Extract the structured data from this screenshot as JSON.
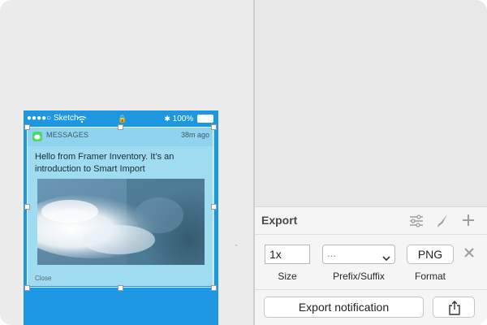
{
  "canvas": {
    "status_bar": {
      "carrier": "●●●●○ Sketch",
      "lock": "🔒",
      "battery": "100%"
    },
    "notification": {
      "app_name": "MESSAGES",
      "time": "38m ago",
      "message": "Hello from Framer Inventory. It’s an introduction to Smart Import",
      "action": "Close"
    }
  },
  "export_panel": {
    "title": "Export",
    "header_icons": [
      "sliders-icon",
      "slice-knife-icon",
      "plus-icon"
    ],
    "size_value": "1x",
    "prefix_placeholder": "...",
    "format_value": "PNG",
    "labels": {
      "size": "Size",
      "prefix_suffix": "Prefix/Suffix",
      "format": "Format"
    },
    "export_button": "Export notification"
  },
  "colors": {
    "phone_blue": "#1e97e3",
    "notification_bg": "#9fdcf1",
    "message_green": "#4cd964"
  }
}
